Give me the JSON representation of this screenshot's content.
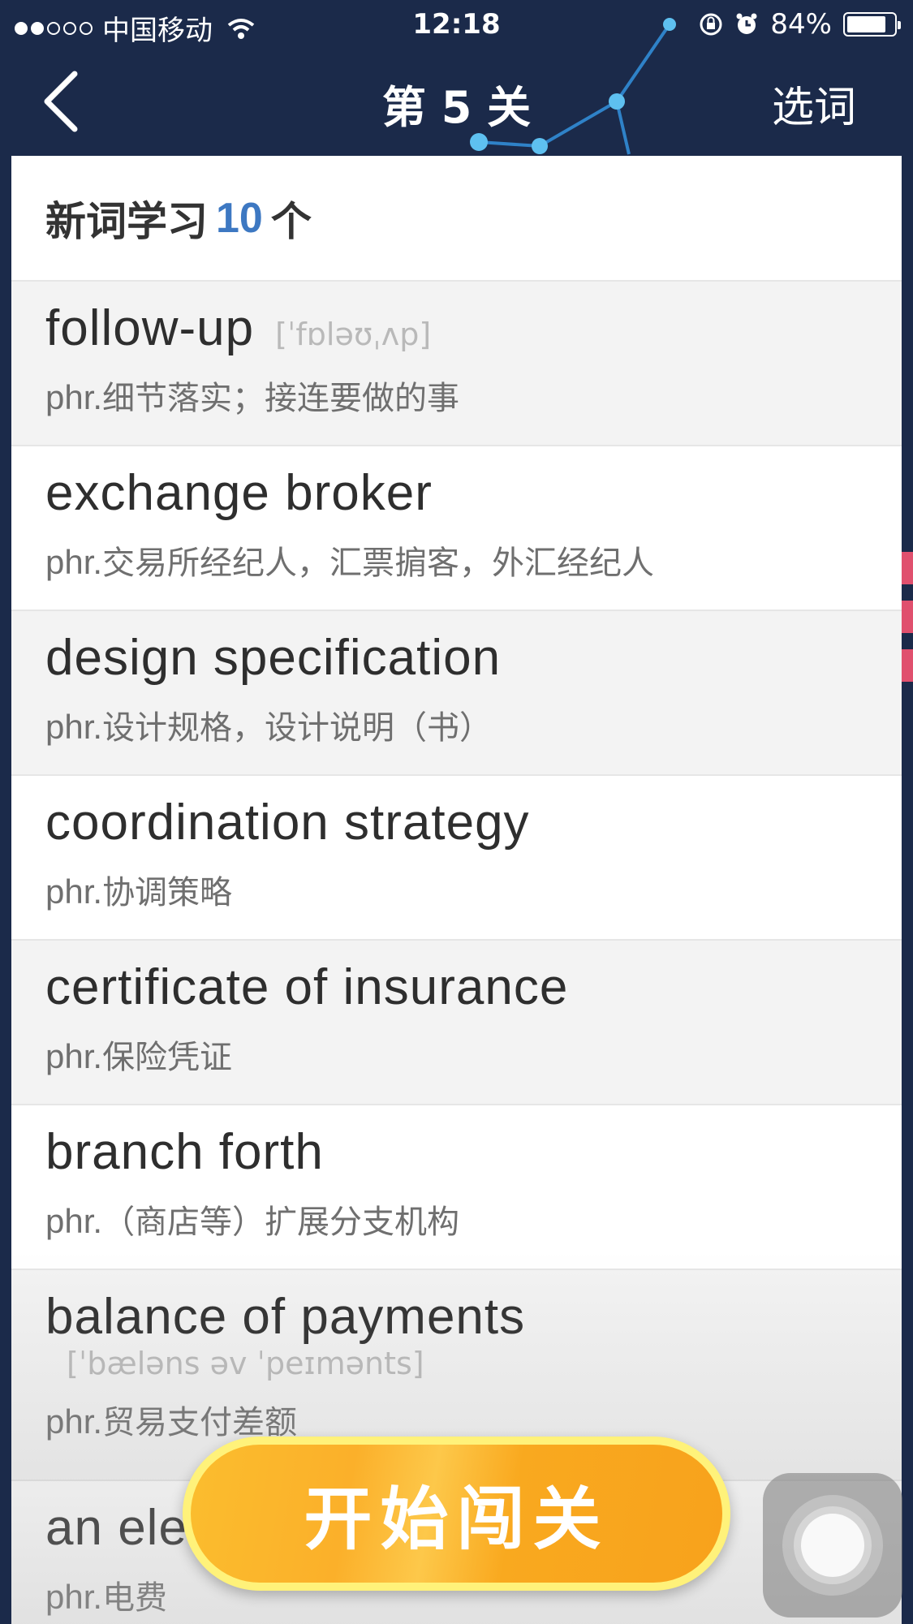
{
  "status_bar": {
    "carrier": "中国移动",
    "time": "12:18",
    "battery": "84%",
    "battery_level": 0.84
  },
  "nav": {
    "title": "第 5 关",
    "right_action": "选词"
  },
  "header": {
    "prefix": "新词学习",
    "count": "10",
    "suffix": "个"
  },
  "words": [
    {
      "word": "follow-up",
      "phonetic": "[ˈfɒləʊˌʌp]",
      "pos": "phr.",
      "definition": "细节落实；接连要做的事"
    },
    {
      "word": "exchange broker",
      "phonetic": "",
      "pos": "phr.",
      "definition": "交易所经纪人，汇票掮客，外汇经纪人"
    },
    {
      "word": "design specification",
      "phonetic": "",
      "pos": "phr.",
      "definition": "设计规格，设计说明（书）"
    },
    {
      "word": "coordination strategy",
      "phonetic": "",
      "pos": "phr.",
      "definition": "协调策略"
    },
    {
      "word": "certificate of insurance",
      "phonetic": "",
      "pos": "phr.",
      "definition": "保险凭证"
    },
    {
      "word": "branch forth",
      "phonetic": "",
      "pos": "phr.",
      "definition": "（商店等）扩展分支机构"
    },
    {
      "word": "balance of payments",
      "phonetic": "[ˈbæləns əv ˈpeɪmənts]",
      "pos": "phr.",
      "definition": "贸易支付差额"
    },
    {
      "word": "an ele",
      "phonetic": "",
      "pos": "phr.",
      "definition": "电费"
    }
  ],
  "start_button": {
    "label": "开始闯关"
  },
  "colors": {
    "background": "#1b2a4a",
    "accent_blue": "#3d78c2",
    "button_orange": "#fbb02a",
    "button_rim": "#fff27a"
  }
}
